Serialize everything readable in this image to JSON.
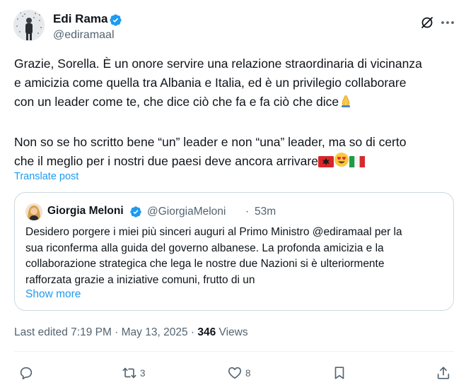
{
  "author": {
    "name": "Edi Rama",
    "handle": "@ediramaal"
  },
  "post": {
    "lines_p1": [
      "Grazie, Sorella. È un onore servire una relazione straordinaria di vicinanza",
      "e amicizia come quella tra Albania e Italia, ed è un privilegio collaborare",
      "con un leader come te, che dice ciò che fa e fa ciò che dice"
    ],
    "lines_p2": [
      "Non so se ho scritto bene “un” leader e non “una” leader, ma so di certo",
      "che il meglio per i nostri due paesi deve ancora arrivare"
    ],
    "emoji_p1": "folded-hands",
    "emoji_p2": [
      "flag-albania",
      "smiling-face-with-heart-eyes",
      "flag-italy"
    ],
    "translate_label": "Translate post"
  },
  "quote": {
    "name": "Giorgia Meloni",
    "handle": "@GiorgiaMeloni",
    "separator": "·",
    "time": "53m",
    "lines": [
      "Desidero porgere i miei più sinceri auguri al Primo Ministro @ediramaal per la",
      "sua riconferma alla guida del governo albanese. La profonda amicizia e la",
      "collaborazione strategica che lega le nostre due Nazioni si è ulteriormente",
      "rafforzata grazie a iniziative comuni, frutto di un"
    ],
    "show_more": "Show more"
  },
  "meta": {
    "edited": "Last edited 7:19 PM · May 13, 2025 · ",
    "views_count": "346",
    "views_label": " Views"
  },
  "actions": {
    "reply_count": "",
    "repost_count": "3",
    "like_count": "8"
  },
  "icons": {
    "verified": "verified-badge-icon",
    "grok": "grok-icon",
    "more": "more-icon",
    "reply": "reply-icon",
    "repost": "repost-icon",
    "like": "like-icon",
    "bookmark": "bookmark-icon",
    "share": "share-icon"
  },
  "colors": {
    "accent": "#1d9bf0",
    "text": "#0f1419",
    "secondary": "#536471",
    "border": "#cfd9de"
  }
}
